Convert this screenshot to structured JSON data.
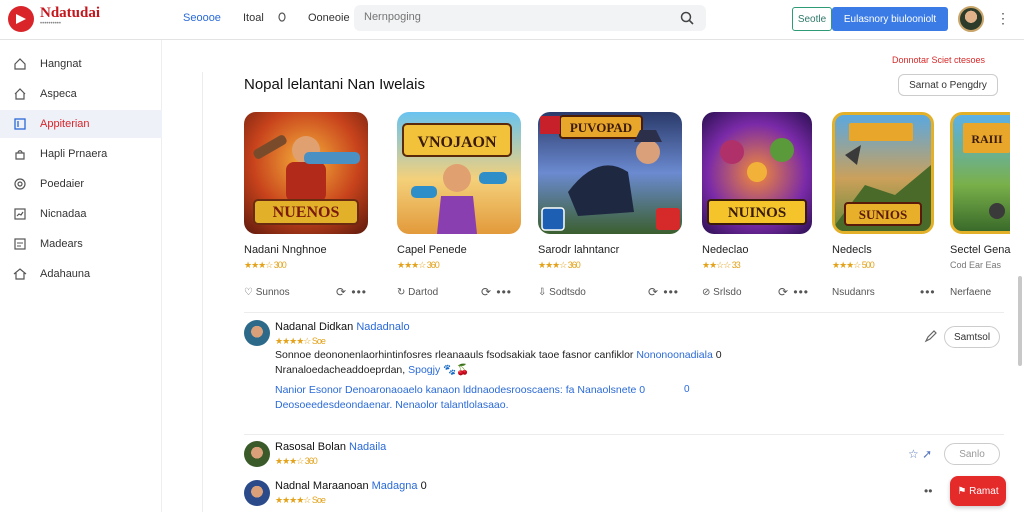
{
  "header": {
    "logo_title": "Ndatudai",
    "logo_sub": "••••••••••",
    "nav": [
      "Seoooe",
      "Itoal",
      "Ooneoie"
    ],
    "search_placeholder": "Nernpoging",
    "btn_green": "Seotle",
    "btn_blue": "Eulasnory biulooniolt",
    "accent": "#3b7be6",
    "brand": "#d9252a"
  },
  "sidebar": {
    "items": [
      {
        "label": "Hangnat",
        "icon": "home-icon"
      },
      {
        "label": "Aspeca",
        "icon": "house-icon"
      },
      {
        "label": "Appiterian",
        "icon": "apps-icon",
        "active": true
      },
      {
        "label": "Hapli Prnaera",
        "icon": "bag-icon"
      },
      {
        "label": "Poedaier",
        "icon": "settings-icon"
      },
      {
        "label": "Nicnadaa",
        "icon": "chart-icon"
      },
      {
        "label": "Madears",
        "icon": "document-icon"
      },
      {
        "label": "Adahauna",
        "icon": "home-outline-icon"
      }
    ]
  },
  "main": {
    "title": "Nopal lelantani Nan Iwelais",
    "red_link": "Donnotar Sciet ctesoes",
    "pill_button": "Sarnat o Pengdry",
    "cards": [
      {
        "name": "Nadani Nnghnoe",
        "rating": "★★★☆ 300",
        "action": "Sunnos",
        "art": "NUENOS"
      },
      {
        "name": "Capel Penede",
        "rating": "★★★☆ 360",
        "action": "Dartod",
        "art": "VNOJAON"
      },
      {
        "name": "Sarodr lahntancr",
        "rating": "★★★☆ 360",
        "action": "Sodtsdo",
        "art": "PUVOPAD"
      },
      {
        "name": "Nedeclao",
        "rating": "★★☆☆ 33",
        "action": "Srlsdo",
        "art": "NUINOS"
      },
      {
        "name": "Nedecls",
        "rating": "★★★☆ 500",
        "action": "Nsudanrs",
        "art": "SUNIOS"
      },
      {
        "name": "Sectel Gena",
        "rating": "Cod Ear Eas",
        "action": "Nerfaene",
        "art": "RAIII"
      }
    ]
  },
  "comments": [
    {
      "name": "Nadanal Didkan",
      "tag": "Nadadnalo",
      "rating": "★★★★☆ Soe",
      "lines": [
        {
          "text": "Sonnoe deononenlaorhintinfosres rleanaauls fsodsakiak taoe fasnor canfiklor",
          "link": "Nononoonadiala",
          "tail": "0"
        },
        {
          "text": "Nranaloedacheaddoeprdan,",
          "link": "Spogjy",
          "tail": "🐾🍒"
        },
        {
          "text": "",
          "link": "Nanior Esonor Denoaronaoaelo kanaon lddnaodesrooscaens:",
          "tail": "fa Nanaolsnete 0"
        },
        {
          "text": "",
          "link": "Deosoeedesdeondaenar.",
          "tail": "Nenaolor talantlolasaao."
        }
      ],
      "button": "Samtsol"
    },
    {
      "name": "Rasosal Bolan",
      "tag": "Nadaila",
      "rating": "★★★☆ 360",
      "button": "Sanlo"
    },
    {
      "name": "Nadnal Maraanoan",
      "tag": "Madagna",
      "rating": "★★★★☆ Soe",
      "button": "Ramat"
    }
  ]
}
